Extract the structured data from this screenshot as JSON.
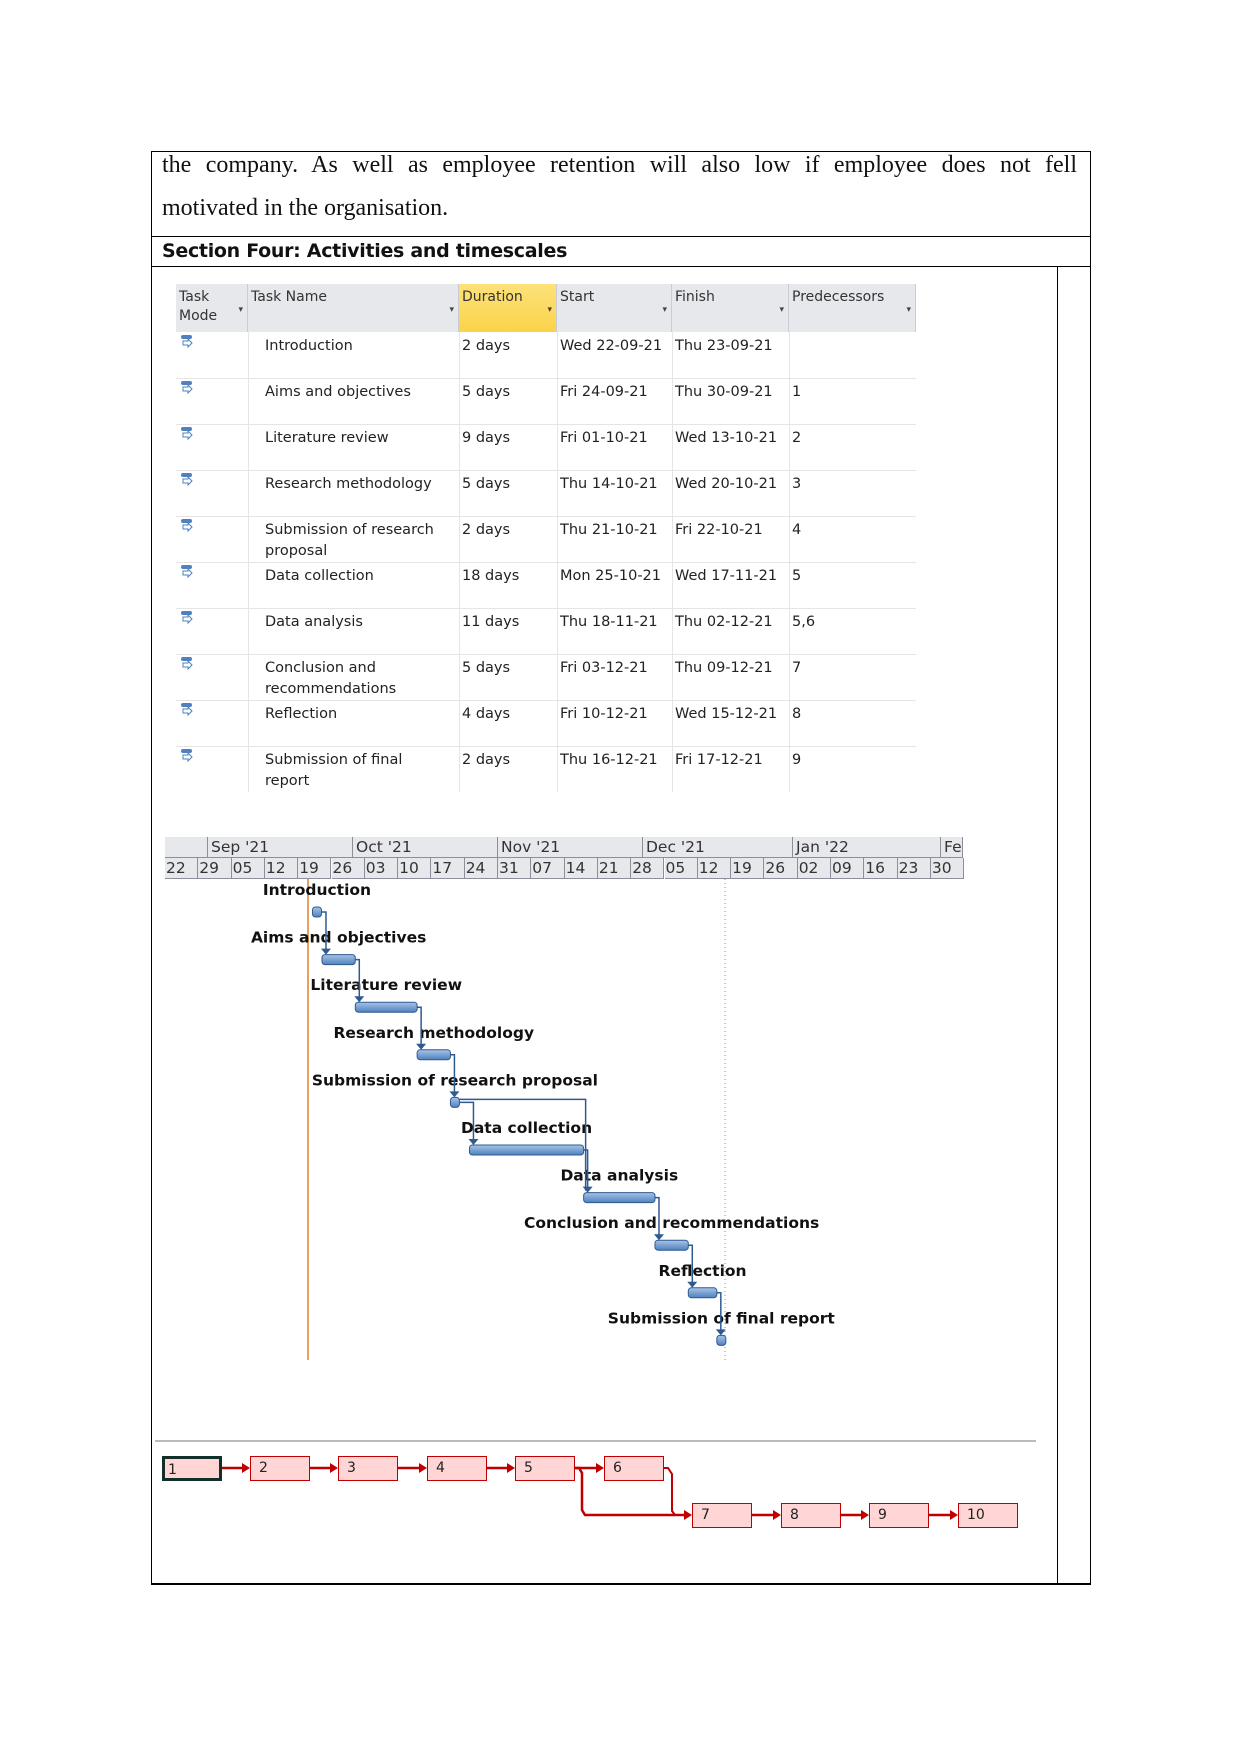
{
  "body_text": {
    "line1": "the company. As well as employee retention will also low if employee does not fell",
    "line2": "motivated in the organisation."
  },
  "section_heading": "Section Four: Activities and timescales",
  "table": {
    "headers": [
      "Task Mode",
      "Task Name",
      "Duration",
      "Start",
      "Finish",
      "Predecessors"
    ],
    "rows": [
      {
        "name": "Introduction",
        "duration": "2 days",
        "start": "Wed 22-09-21",
        "finish": "Thu 23-09-21",
        "pred": ""
      },
      {
        "name": "Aims and objectives",
        "duration": "5 days",
        "start": "Fri 24-09-21",
        "finish": "Thu 30-09-21",
        "pred": "1"
      },
      {
        "name": "Literature review",
        "duration": "9 days",
        "start": "Fri 01-10-21",
        "finish": "Wed 13-10-21",
        "pred": "2"
      },
      {
        "name": "Research methodology",
        "duration": "5 days",
        "start": "Thu 14-10-21",
        "finish": "Wed 20-10-21",
        "pred": "3"
      },
      {
        "name": "Submission of research proposal",
        "duration": "2 days",
        "start": "Thu 21-10-21",
        "finish": "Fri 22-10-21",
        "pred": "4"
      },
      {
        "name": "Data collection",
        "duration": "18 days",
        "start": "Mon 25-10-21",
        "finish": "Wed 17-11-21",
        "pred": "5"
      },
      {
        "name": "Data analysis",
        "duration": "11 days",
        "start": "Thu 18-11-21",
        "finish": "Thu 02-12-21",
        "pred": "5,6"
      },
      {
        "name": "Conclusion and recommendations",
        "duration": "5 days",
        "start": "Fri 03-12-21",
        "finish": "Thu 09-12-21",
        "pred": "7"
      },
      {
        "name": "Reflection",
        "duration": "4 days",
        "start": "Fri 10-12-21",
        "finish": "Wed 15-12-21",
        "pred": "8"
      },
      {
        "name": "Submission of final report",
        "duration": "2 days",
        "start": "Thu 16-12-21",
        "finish": "Fri 17-12-21",
        "pred": "9"
      }
    ]
  },
  "timeline": {
    "months": [
      "",
      "Sep '21",
      "Oct '21",
      "Nov '21",
      "Dec '21",
      "Jan '22",
      "Fe"
    ],
    "weeks": [
      "22",
      "29",
      "05",
      "12",
      "19",
      "26",
      "03",
      "10",
      "17",
      "24",
      "31",
      "07",
      "14",
      "21",
      "28",
      "05",
      "12",
      "19",
      "26",
      "02",
      "09",
      "16",
      "23",
      "30"
    ]
  },
  "gantt": {
    "bar_color": "#4f81bd",
    "today_line_color": "#e8a060",
    "tasks": [
      {
        "label": "Introduction",
        "start": "2021-09-22",
        "finish": "2021-09-23"
      },
      {
        "label": "Aims and objectives",
        "start": "2021-09-24",
        "finish": "2021-09-30"
      },
      {
        "label": "Literature review",
        "start": "2021-10-01",
        "finish": "2021-10-13"
      },
      {
        "label": "Research methodology",
        "start": "2021-10-14",
        "finish": "2021-10-20"
      },
      {
        "label": "Submission of research proposal",
        "start": "2021-10-21",
        "finish": "2021-10-22"
      },
      {
        "label": "Data collection",
        "start": "2021-10-25",
        "finish": "2021-11-17"
      },
      {
        "label": "Data analysis",
        "start": "2021-11-18",
        "finish": "2021-12-02"
      },
      {
        "label": "Conclusion and recommendations",
        "start": "2021-12-03",
        "finish": "2021-12-09"
      },
      {
        "label": "Reflection",
        "start": "2021-12-10",
        "finish": "2021-12-15"
      },
      {
        "label": "Submission of final report",
        "start": "2021-12-16",
        "finish": "2021-12-17"
      }
    ]
  },
  "network": {
    "nodes": [
      "1",
      "2",
      "3",
      "4",
      "5",
      "6",
      "7",
      "8",
      "9",
      "10"
    ],
    "box_fill": "#ffd5d5",
    "line_color": "#c00000"
  }
}
